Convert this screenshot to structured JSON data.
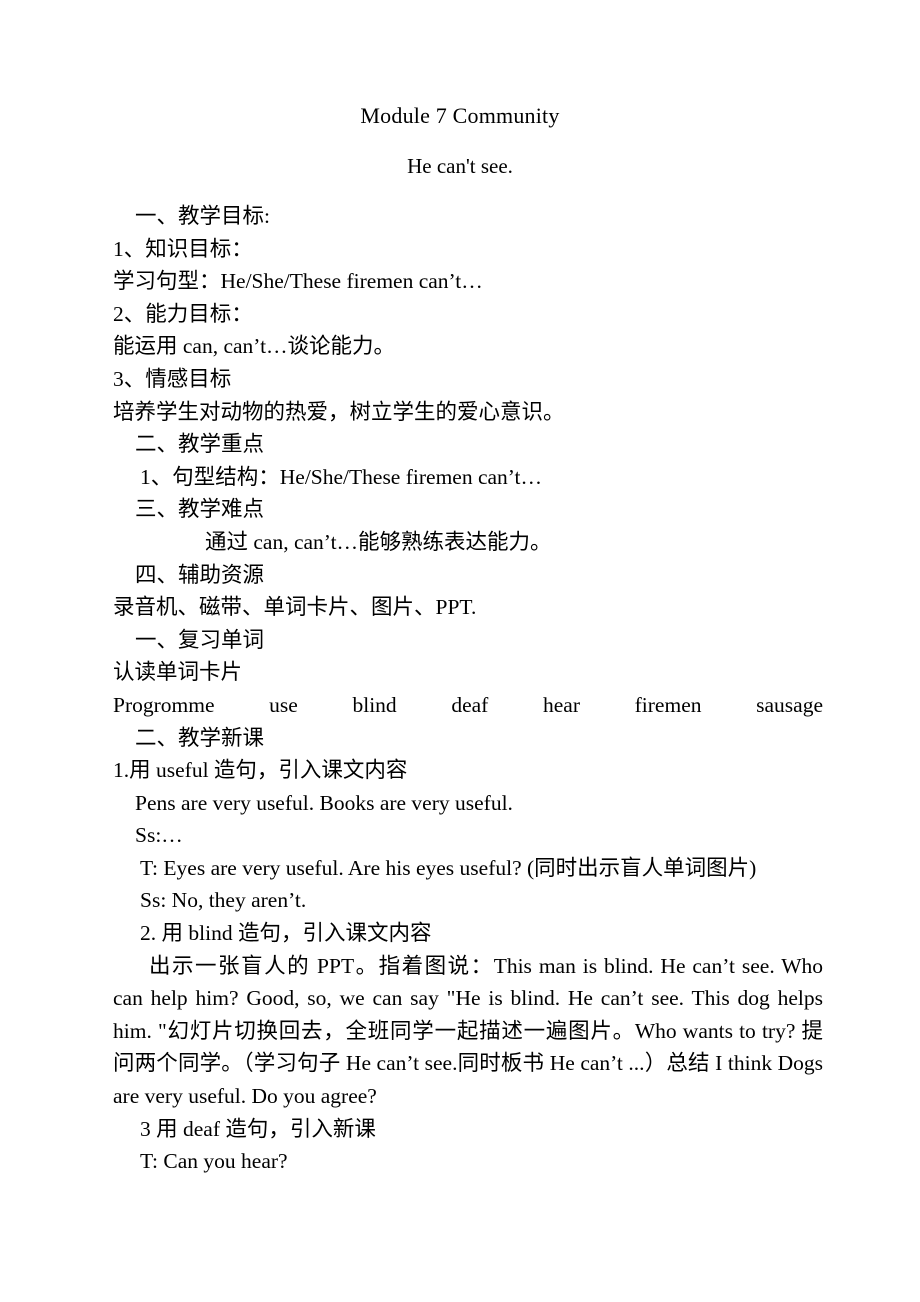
{
  "document": {
    "title": "Module 7 Community",
    "subtitle": "He can't see."
  },
  "lines": {
    "l01": "一、教学目标:",
    "l02": "1、知识目标：",
    "l03": "学习句型：He/She/These firemen can’t…",
    "l04": "2、能力目标：",
    "l05": "能运用 can, can’t…谈论能力。",
    "l06": "3、情感目标",
    "l07": "培养学生对动物的热爱，树立学生的爱心意识。",
    "l08": "二、教学重点",
    "l09": "1、句型结构：He/She/These firemen can’t…",
    "l10": "三、教学难点",
    "l11": "通过 can, can’t…能够熟练表达能力。",
    "l12": "四、辅助资源",
    "l13": "录音机、磁带、单词卡片、图片、PPT.",
    "l14": "一、复习单词",
    "l15": "认读单词卡片",
    "l16": "Progromme use blind deaf hear firemen sausage",
    "l17": "二、教学新课",
    "l18": "1.用 useful 造句，引入课文内容",
    "l19": "Pens are very useful. Books are very useful.",
    "l20": "Ss:…",
    "l21": "T: Eyes are very useful. Are his eyes useful? (同时出示盲人单词图片)",
    "l22": "Ss: No, they aren’t.",
    "l23": "2. 用 blind 造句，引入课文内容",
    "l24": "出示一张盲人的 PPT。指着图说：This man is blind. He can’t see. Who can help him? Good, so, we can say \"He is blind. He can’t see. This dog helps him. \"幻灯片切换回去，全班同学一起描述一遍图片。Who wants to try? 提问两个同学。（学习句子 He can’t see.同时板书 He can’t ...）总结 I think Dogs are very useful. Do you agree?",
    "l25": "3 用 deaf 造句，引入新课",
    "l26": "T: Can you hear?"
  },
  "wordlist": {
    "words": [
      "Progromme",
      "use",
      "blind",
      "deaf",
      "hear",
      "firemen",
      "sausage"
    ]
  },
  "colors": {
    "page_background": "#ffffff",
    "text": "#000000"
  }
}
